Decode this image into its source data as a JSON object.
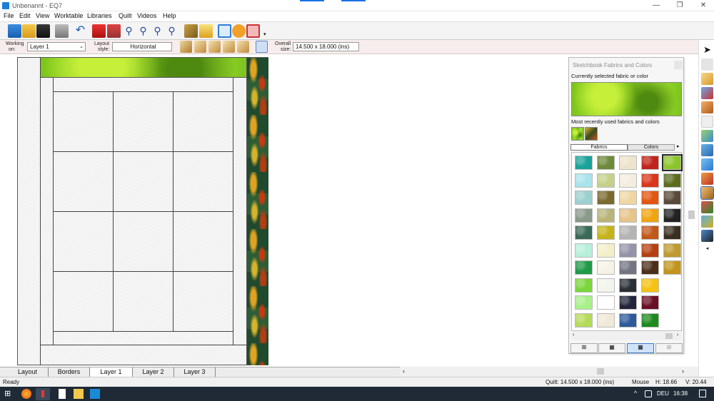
{
  "window": {
    "title": "Unbenannt - EQ7",
    "minimize": "—",
    "maximize": "❐",
    "close": "✕"
  },
  "menu": [
    "File",
    "Edit",
    "View",
    "Worktable",
    "Libraries",
    "Quilt",
    "Videos",
    "Help"
  ],
  "toolbar_icons": [
    "new-file-icon",
    "open-folder-icon",
    "save-icon",
    "print-icon",
    "undo-icon",
    "add-to-sketchbook-icon",
    "view-sketchbook-icon",
    "zoom-in-icon",
    "zoom-out-icon",
    "refresh-view-icon",
    "fit-to-worktable-icon",
    "rulers-icon",
    "help-icon",
    "layout-tab-icon",
    "borders-tab-icon",
    "layer-tab-icon"
  ],
  "options": {
    "working_on_label1": "Working",
    "working_on_label2": "on:",
    "working_on_value": "Layer 1",
    "layout_style_label1": "Layout",
    "layout_style_label2": "style:",
    "layout_style_value": "Horizontal",
    "overall_size_label1": "Overall",
    "overall_size_label2": "size:",
    "overall_size_value": "14.500 x 18.000 (ins)"
  },
  "panel": {
    "title": "Sketchbook Fabrics and Colors",
    "current_label": "Currently selected fabric or color",
    "recent_label": "Most recently used fabrics and colors",
    "tab_fabrics": "Fabrics",
    "tab_colors": "Colors",
    "swatch_colors": [
      [
        "#1aa39a",
        "#6f8a3b",
        "#efe3cc",
        "#c0241a",
        "#8cc52a"
      ],
      [
        "#a9e3ec",
        "#c5d08a",
        "#f4ecdf",
        "#d9361a",
        "#5e6c1f"
      ],
      [
        "#9ccfcf",
        "#7a6a2e",
        "#f0d6a3",
        "#e2540f",
        "#5a4a3a"
      ],
      [
        "#8a9a8a",
        "#b8b47a",
        "#e6c48a",
        "#f2a40e",
        "#222222"
      ],
      [
        "#3b6a56",
        "#c6b319",
        "#b4b4b4",
        "#c2571a",
        "#3a2e20"
      ],
      [
        "#b7efd9",
        "#f3efc9",
        "#9494a8",
        "#b4400f",
        "#bf9a2e"
      ],
      [
        "#1f9a48",
        "#f6f2e6",
        "#747482",
        "#4a2e1a",
        "#c29419"
      ],
      [
        "#7ad63a",
        "#f4f4ee",
        "#2a2e36",
        "#f5c210",
        ""
      ],
      [
        "#a9f08a",
        "#ffffff",
        "#23263a",
        "#6a0f26",
        ""
      ],
      [
        "#b6da5a",
        "#f0e8d9",
        "#2e5a9a",
        "#1c8a1c",
        ""
      ]
    ]
  },
  "tabs": [
    "Layout",
    "Borders",
    "Layer 1",
    "Layer 2",
    "Layer 3"
  ],
  "status": {
    "left": "Ready",
    "quilt": "Quilt: 14.500 x 18.000 (ins)",
    "mouse": "Mouse",
    "h": "H: 18.66",
    "v": "V: 20.44"
  },
  "taskbar": {
    "lang": "DEU",
    "time": "16:38",
    "up_arrow": "^"
  }
}
